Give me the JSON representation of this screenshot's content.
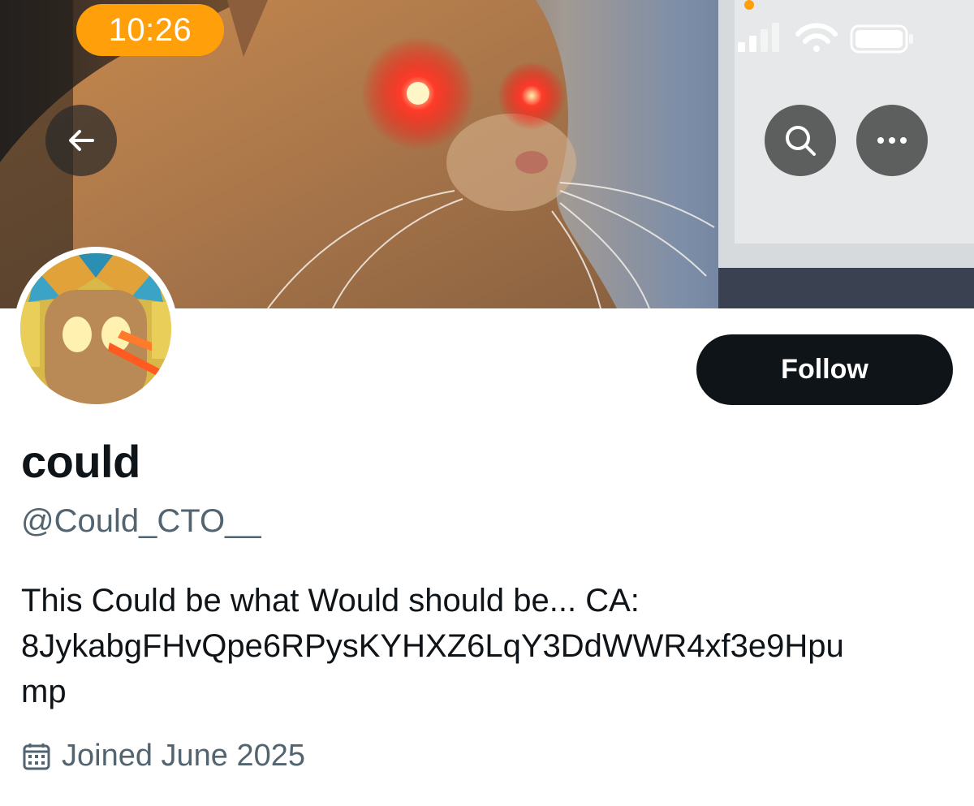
{
  "status_bar": {
    "time": "10:26",
    "icons": [
      "signal-icon",
      "wifi-icon",
      "battery-icon"
    ],
    "accent_color": "#ff9f0a"
  },
  "header": {
    "banner": "cat-with-glowing-red-eyes-banner",
    "buttons": [
      "back-arrow-icon",
      "search-icon",
      "more-icon"
    ]
  },
  "profile": {
    "display_name": "could",
    "handle": "@Could_CTO__",
    "follow_label": "Follow",
    "bio_lines": [
      "This Could be what Would should be... CA:",
      "8JykabgFHvQpe6RPysKYHXZ6LqY3DdWWR4xf3e9Hpu",
      "mp"
    ],
    "joined": "Joined June 2025",
    "colors": {
      "primary_text": "#0f1419",
      "secondary_text": "#536471",
      "button_bg": "#0f1419"
    }
  }
}
